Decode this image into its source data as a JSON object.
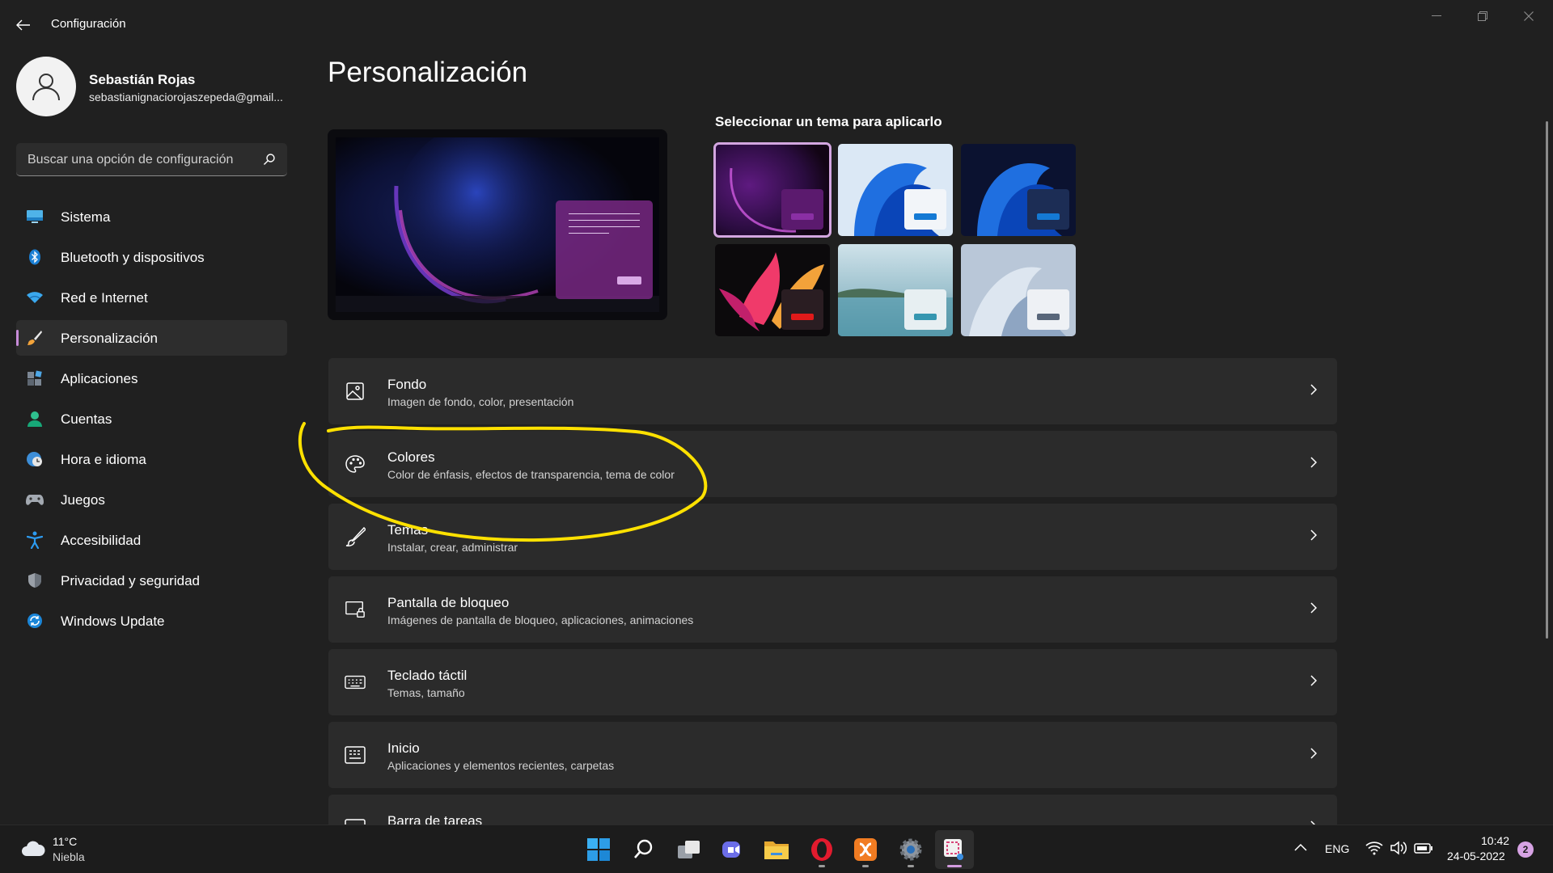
{
  "window": {
    "title": "Configuración"
  },
  "profile": {
    "name": "Sebastián Rojas",
    "email": "sebastianignaciorojaszepeda@gmail..."
  },
  "search": {
    "placeholder": "Buscar una opción de configuración"
  },
  "sidebar": {
    "items": [
      {
        "label": "Sistema",
        "icon": "monitor-icon",
        "active": false
      },
      {
        "label": "Bluetooth y dispositivos",
        "icon": "bluetooth-icon",
        "active": false
      },
      {
        "label": "Red e Internet",
        "icon": "wifi-icon",
        "active": false
      },
      {
        "label": "Personalización",
        "icon": "paintbrush-icon",
        "active": true
      },
      {
        "label": "Aplicaciones",
        "icon": "apps-icon",
        "active": false
      },
      {
        "label": "Cuentas",
        "icon": "person-icon",
        "active": false
      },
      {
        "label": "Hora e idioma",
        "icon": "clock-globe-icon",
        "active": false
      },
      {
        "label": "Juegos",
        "icon": "gamepad-icon",
        "active": false
      },
      {
        "label": "Accesibilidad",
        "icon": "accessibility-icon",
        "active": false
      },
      {
        "label": "Privacidad y seguridad",
        "icon": "shield-icon",
        "active": false
      },
      {
        "label": "Windows Update",
        "icon": "update-icon",
        "active": false
      }
    ]
  },
  "main": {
    "title": "Personalización",
    "themes_heading": "Seleccionar un tema para aplicarlo",
    "rows": [
      {
        "title": "Fondo",
        "subtitle": "Imagen de fondo, color, presentación",
        "icon": "image-icon"
      },
      {
        "title": "Colores",
        "subtitle": "Color de énfasis, efectos de transparencia, tema de color",
        "icon": "palette-icon"
      },
      {
        "title": "Temas",
        "subtitle": "Instalar, crear, administrar",
        "icon": "brush-icon"
      },
      {
        "title": "Pantalla de bloqueo",
        "subtitle": "Imágenes de pantalla de bloqueo, aplicaciones, animaciones",
        "icon": "lock-screen-icon"
      },
      {
        "title": "Teclado táctil",
        "subtitle": "Temas, tamaño",
        "icon": "keyboard-icon"
      },
      {
        "title": "Inicio",
        "subtitle": "Aplicaciones y elementos recientes, carpetas",
        "icon": "start-icon"
      },
      {
        "title": "Barra de tareas",
        "subtitle": "",
        "icon": "taskbar-icon"
      }
    ]
  },
  "colors": {
    "accent": "#c78bd8",
    "highlight": "#ffe100",
    "background": "#202020",
    "card": "#2b2b2b"
  },
  "taskbar": {
    "weather_temp": "11°C",
    "weather_desc": "Niebla",
    "language": "ENG",
    "time": "10:42",
    "date": "24-05-2022",
    "notifications": "2"
  }
}
